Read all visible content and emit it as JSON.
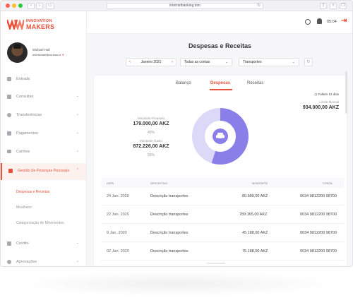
{
  "browser": {
    "url": "internetbanking.inm"
  },
  "brand": {
    "line1": "INNOVATION",
    "line2": "MAKERS",
    "accent": "#e8503a"
  },
  "profile": {
    "name": "Michael Hall",
    "email": "mcmichael@curious.io"
  },
  "sidebar": {
    "items": [
      {
        "label": "Entrada",
        "icon": "home-icon"
      },
      {
        "label": "Consultas",
        "icon": "chart-icon"
      },
      {
        "label": "Transferências",
        "icon": "transfer-icon"
      },
      {
        "label": "Pagamentos",
        "icon": "payment-icon"
      },
      {
        "label": "Cartões",
        "icon": "card-icon"
      },
      {
        "label": "Gestão de Finanças Pessoais",
        "icon": "finance-icon"
      },
      {
        "label": "Crédito",
        "icon": "credit-icon"
      },
      {
        "label": "Aprovações",
        "icon": "approval-icon"
      }
    ],
    "subitems": [
      "Despesas e Receitas",
      "Mealheiro",
      "Categorização de Movimentos"
    ]
  },
  "topbar": {
    "time": "05:04"
  },
  "page": {
    "title": "Despesas e Receitas"
  },
  "filters": {
    "date": "Janeiro 2021",
    "accounts": "Todas as contas",
    "category": "Transportes"
  },
  "tabs": [
    "Balanço",
    "Despesas",
    "Receitas"
  ],
  "summary": {
    "days_left": "Faltam 12 dias",
    "limit_label": "Limite Mensal",
    "limit_value": "934.000,00 AKZ",
    "spent_label": "Montante Poupado",
    "spent_value": "179.000,00 AKZ",
    "spent_pct": "45%",
    "remaining_label": "Montante Gasto",
    "remaining_value": "872.226,00 AKZ",
    "remaining_pct": "55%",
    "donut_fraction_spent": 0.55,
    "colors": {
      "spent": "#8a7fe8",
      "saved": "#dcd8f7"
    }
  },
  "table": {
    "headers": [
      "DATA",
      "DESCRITIVO",
      "MONTANTE",
      "CONTA"
    ],
    "rows": [
      {
        "date": "24 Jan. 2020",
        "desc": "Descrição transportes",
        "amount": "80.689,00 AKZ",
        "account": "0034 9812200 98700"
      },
      {
        "date": "22 Jan. 2020",
        "desc": "Descrição transportes",
        "amount": "789.365,00 AKZ",
        "account": "0034 9812200 98700"
      },
      {
        "date": "9 Jan. 2020",
        "desc": "Descrição transportes",
        "amount": "45.188,00 AKZ",
        "account": "0034 9812200 98700"
      },
      {
        "date": "02 Jan. 2020",
        "desc": "Descrição transportes",
        "amount": "75.188,00 AKZ",
        "account": "0034 9812200 98700"
      }
    ]
  }
}
